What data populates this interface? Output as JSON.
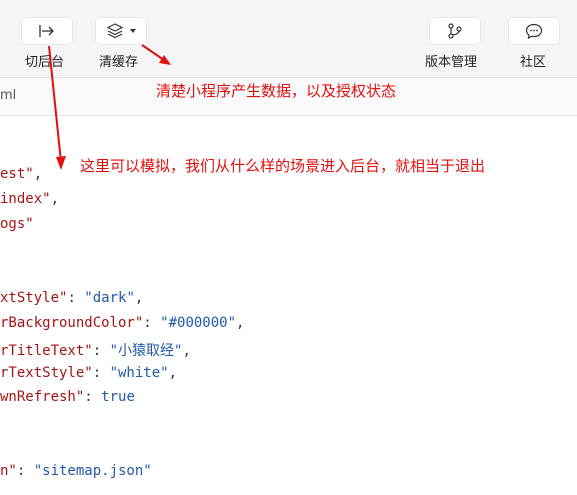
{
  "toolbar": {
    "items": [
      {
        "label": "切后台",
        "icon": "background-switch-icon"
      },
      {
        "label": "清缓存",
        "icon": "layers-icon"
      },
      {
        "label": "版本管理",
        "icon": "branch-icon"
      },
      {
        "label": "社区",
        "icon": "chat-bubble-icon"
      }
    ]
  },
  "file_tab": "ml",
  "code_lines": {
    "l1": {
      "k": "est\"",
      "p": ","
    },
    "l2": {
      "k": "index\"",
      "p": ","
    },
    "l3": {
      "k": "ogs\""
    },
    "l4": {
      "k": "xtStyle\"",
      "p": ": ",
      "v": "\"dark\"",
      "e": ","
    },
    "l5": {
      "k": "rBackgroundColor\"",
      "p": ": ",
      "v": "\"#000000\"",
      "e": ","
    },
    "l6": {
      "k": "rTitleText\"",
      "p": ": ",
      "v": "\"小猿取经\"",
      "e": ","
    },
    "l7": {
      "k": "rTextStyle\"",
      "p": ": ",
      "v": "\"white\"",
      "e": ","
    },
    "l8": {
      "k": "wnRefresh\"",
      "p": ": ",
      "v": "true"
    },
    "l9": {
      "k": "n\"",
      "p": ": ",
      "v": "\"sitemap.json\""
    }
  },
  "annotations": {
    "cache": "清楚小程序产生数据，以及授权状态",
    "background": "这里可以模拟，我们从什么样的场景进入后台，就相当于退出"
  },
  "colors": {
    "annotation": "#e01010",
    "json_key": "#a31515",
    "json_value": "#1e5aa8"
  }
}
